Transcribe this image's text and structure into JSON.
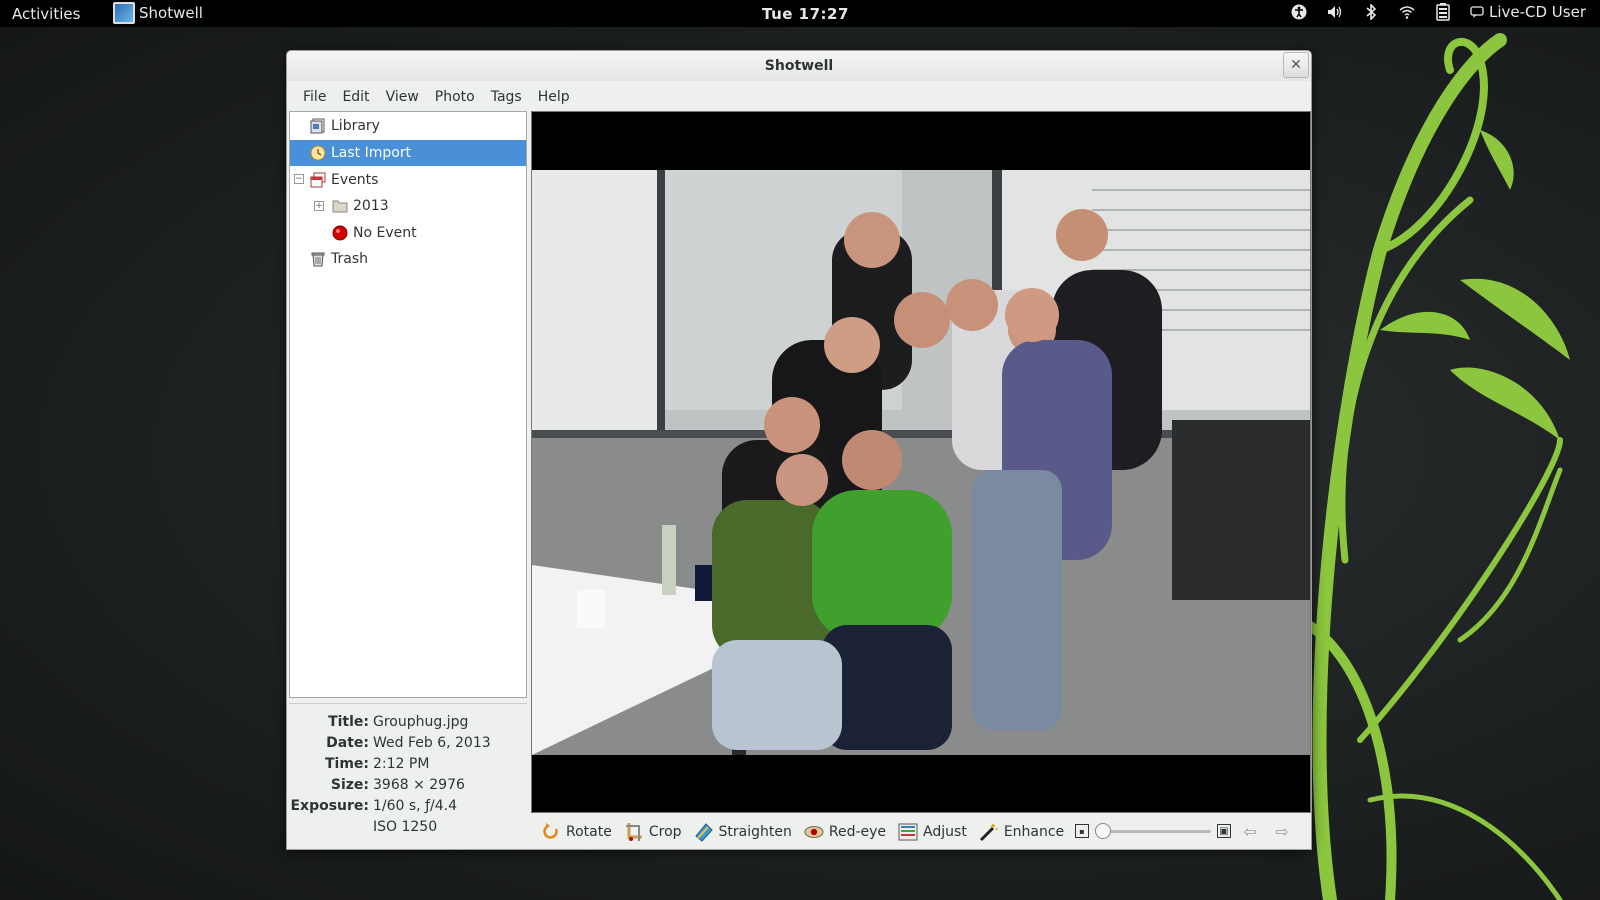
{
  "topbar": {
    "activities": "Activities",
    "app_name": "Shotwell",
    "clock": "Tue 17:27",
    "status_icons": [
      "accessibility-icon",
      "volume-icon",
      "bluetooth-icon",
      "wifi-icon",
      "battery-icon"
    ],
    "user": "Live-CD User"
  },
  "window": {
    "title": "Shotwell",
    "close_glyph": "✕"
  },
  "menu": [
    "File",
    "Edit",
    "View",
    "Photo",
    "Tags",
    "Help"
  ],
  "sidebar": {
    "items": [
      {
        "label": "Library",
        "icon": "library-icon"
      },
      {
        "label": "Last Import",
        "icon": "last-import-icon",
        "selected": true
      },
      {
        "label": "Events",
        "icon": "events-icon",
        "expander": "−"
      },
      {
        "label": "2013",
        "icon": "folder-icon",
        "expander": "+"
      },
      {
        "label": "No Event",
        "icon": "no-event-icon"
      },
      {
        "label": "Trash",
        "icon": "trash-icon"
      }
    ]
  },
  "info": {
    "title_label": "Title:",
    "title_value": "Grouphug.jpg",
    "date_label": "Date:",
    "date_value": "Wed Feb 6, 2013",
    "time_label": "Time:",
    "time_value": "2:12 PM",
    "size_label": "Size:",
    "size_value": "3968 × 2976",
    "exposure_label": "Exposure:",
    "exposure_value": "1/60 s, ƒ/4.4",
    "iso_value": "ISO 1250"
  },
  "toolbar": {
    "rotate": "Rotate",
    "crop": "Crop",
    "straighten": "Straighten",
    "redeye": "Red-eye",
    "adjust": "Adjust",
    "enhance": "Enhance"
  },
  "zoom": {
    "level": 0
  },
  "colors": {
    "selection": "#4a90d9",
    "vine_green": "#8cc63f",
    "topbar": "#000000"
  }
}
